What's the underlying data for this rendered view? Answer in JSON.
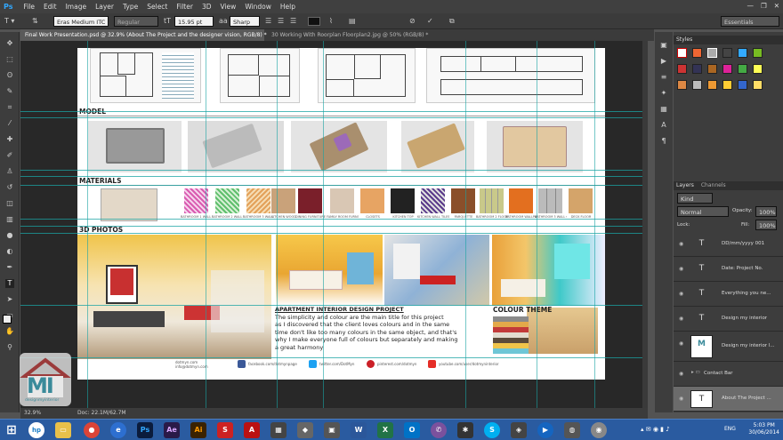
{
  "menu": {
    "app": "Ps",
    "items": [
      "File",
      "Edit",
      "Image",
      "Layer",
      "Type",
      "Select",
      "Filter",
      "3D",
      "View",
      "Window",
      "Help"
    ]
  },
  "options": {
    "font_family": "Eras Medium ITC",
    "font_style": "Regular",
    "font_size": "15.95 pt",
    "antialias": "Sharp",
    "workspace": "Essentials"
  },
  "tabs": [
    {
      "label": "Final Work Presentation.psd @ 32.9% (About The Project and the designer vision, RGB/8) *"
    },
    {
      "label": "30 Working With Roorplan Floorplan2.jpg @ 50% (RGB/8) *"
    }
  ],
  "document": {
    "sections": {
      "model": "MODEL",
      "materials": "MATERIALS",
      "photos": "3D PHOTOS",
      "colour_theme": "COLOUR THEME"
    },
    "material_labels": [
      "BATHROOM 1 WALL TILES",
      "BATHROOM 2 WALL TILES",
      "BATHROOM 3 WALL TILES",
      "KITCHEN WOOD",
      "DINING FURNITURE",
      "FAMILY ROOM FURNITURE",
      "CLOSETS",
      "KITCHEN TOP",
      "KITCHEN WALL TILES",
      "PARQUETTE",
      "BATHROOM 2 FLOOR TILES",
      "BATHROOM WALLPAPER",
      "BATHROOM 3 WALL COVERING",
      "DECK FLOOR"
    ],
    "desc_title": "APARTMENT INTERIOR DESIGN PROJECT",
    "desc_lines": [
      "The simplicity and colour are the main title for this project",
      "as I discovered that the client loves colours and in the same",
      "time don't like too many colours in the same object, and that's",
      "why I make everyone full of colours but separately and making",
      "a great harmony"
    ],
    "footer": {
      "site": "dotmyn.com",
      "email": "info@dotmyn.com",
      "facebook": "facebook.com/dotmynpage",
      "twitter": "twitter.com/DotMyn",
      "pinterest": "pinterest.com/dotmyn",
      "youtube": "youtube.com/user/dotmyninterior"
    }
  },
  "status": {
    "zoom": "32.9%",
    "doc": "Doc: 22.1M/62.7M"
  },
  "panels": {
    "styles": "Styles",
    "layers_tab": "Layers",
    "channels_tab": "Channels",
    "kind": "Kind",
    "blend": "Normal",
    "opacity_label": "Opacity:",
    "opacity": "100%",
    "lock_label": "Lock:",
    "fill_label": "Fill:",
    "fill": "100%",
    "layers": [
      {
        "name": "DD/mm/yyyy 001",
        "type": "T"
      },
      {
        "name": "Date: Project No.",
        "type": "T"
      },
      {
        "name": "Everything you ne...",
        "type": "T"
      },
      {
        "name": "Design my interior",
        "type": "T"
      },
      {
        "name": "Design my interior l...",
        "type": "logo"
      },
      {
        "name": "Contact Bar",
        "type": "folder"
      },
      {
        "name": "About The Project ...",
        "type": "T",
        "selected": true
      }
    ]
  },
  "logo": {
    "letters": "MI",
    "text": "designmyinterior"
  },
  "taskbar": {
    "lang": "ENG",
    "time": "5:03 PM",
    "date": "30/06/2014"
  }
}
